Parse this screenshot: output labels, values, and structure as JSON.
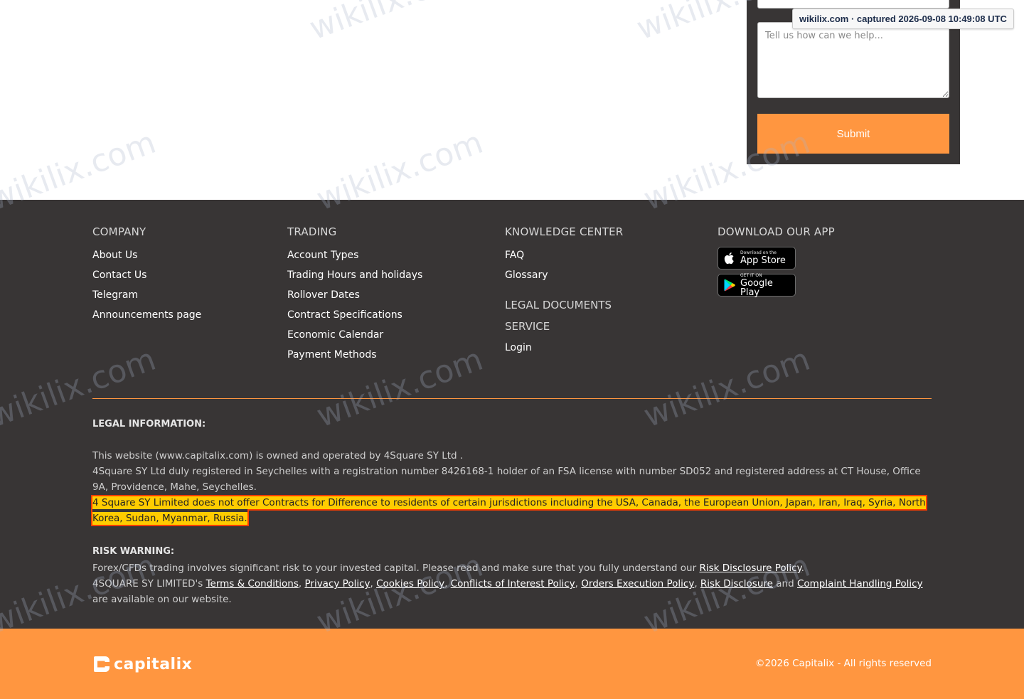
{
  "contact_form": {
    "message_placeholder": "Tell us how can we help...",
    "submit_label": "Submit"
  },
  "capture_badge": "wikilix.com · captured 2026-09-08 10:49:08 UTC",
  "footer": {
    "company": {
      "title": "COMPANY",
      "links": [
        "About Us",
        "Contact Us",
        "Telegram",
        "Announcements page"
      ]
    },
    "trading": {
      "title": "TRADING",
      "links": [
        "Account Types",
        "Trading Hours and holidays",
        "Rollover Dates",
        "Contract Specifications",
        "Economic Calendar",
        "Payment Methods"
      ]
    },
    "knowledge": {
      "title": "KNOWLEDGE CENTER",
      "links": [
        "FAQ",
        "Glossary"
      ],
      "legal_documents_title": "LEGAL DOCUMENTS",
      "service_title": "SERVICE",
      "service_links": [
        "Login"
      ]
    },
    "app": {
      "title": "DOWNLOAD OUR APP",
      "app_store_small": "Download on the",
      "app_store_big": "App Store",
      "google_play_small": "GET IT ON",
      "google_play_big": "Google Play"
    }
  },
  "legal": {
    "title": "LEGAL INFORMATION:",
    "line1": "This website (www.capitalix.com) is owned and operated by 4Square SY Ltd .",
    "line2": "4Square SY Ltd duly registered in Seychelles with a registration number 8426168-1 holder of an FSA license with number SD052 and registered address at CT House, Office 9A, Providence, Mahe, Seychelles.",
    "highlighted": "4 Square SY Limited does not offer Contracts for Difference to residents of certain jurisdictions including the USA, Canada, the European Union, Japan, Iran, Iraq, Syria, North Korea, Sudan, Myanmar, Russia."
  },
  "risk": {
    "title": "RISK WARNING:",
    "line1_prefix": "Forex/CFDs trading involves significant risk to your invested capital. Please read and make sure that you fully understand our",
    "line1_link": "Risk Disclosure Policy",
    "line1_suffix": ".",
    "line2_prefix": "4SQUARE SY LIMITED's",
    "links": [
      "Terms & Conditions",
      "Privacy Policy",
      "Cookies Policy",
      "Conflicts of Interest Policy",
      "Orders Execution Policy",
      "Risk Disclosure"
    ],
    "and_text": "and",
    "last_link": "Complaint Handling Policy",
    "line2_suffix": "are available on our website."
  },
  "bottom": {
    "logo_text": "capitalix",
    "copyright": "©2026 Capitalix - All rights reserved"
  },
  "colors": {
    "accent_orange": "#ff9640",
    "footer_dark": "#383535",
    "highlight": "#ffcc00"
  },
  "watermark_text": "wikilix.com"
}
